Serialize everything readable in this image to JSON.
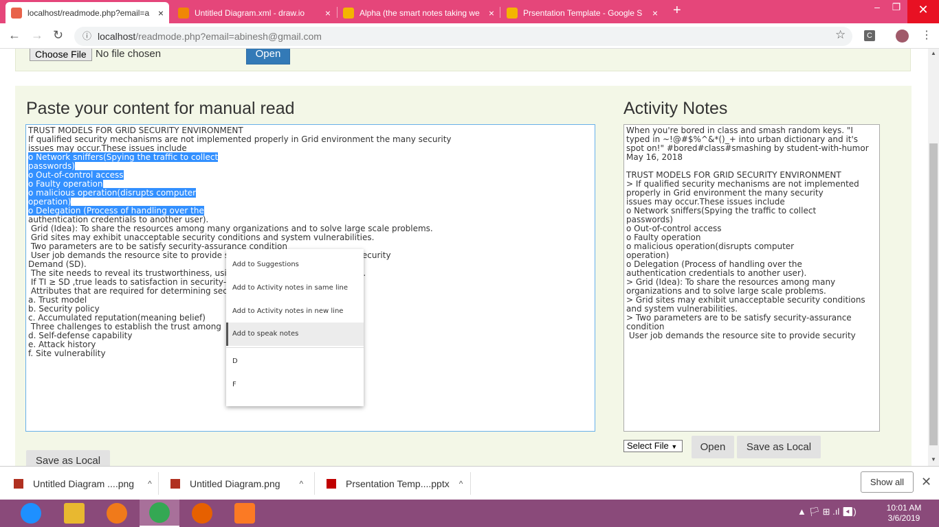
{
  "browser": {
    "tabs": [
      {
        "title": "localhost/readmode.php?email=a",
        "favicon_color": "#e8624a",
        "close": "×"
      },
      {
        "title": "Untitled Diagram.xml - draw.io",
        "favicon_color": "#f08705",
        "close": "×"
      },
      {
        "title": "Alpha (the smart notes taking we",
        "favicon_color": "#f4b400",
        "close": "×"
      },
      {
        "title": "Prsentation Template - Google S",
        "favicon_color": "#f4b400",
        "close": "×"
      }
    ],
    "new_tab": "+",
    "window_controls": [
      "–",
      "❐",
      "✕"
    ],
    "url_host": "localhost",
    "url_path": "/readmode.php?email=abinesh@gmail.com",
    "extension_letter": "C"
  },
  "upper_panel": {
    "choose_file": "Choose File",
    "no_file": "No file chosen",
    "open": "Open"
  },
  "manual": {
    "heading": "Paste your content for manual read",
    "lines": [
      {
        "text": "TRUST MODELS FOR GRID SECURITY ENVIRONMENT",
        "sel": false
      },
      {
        "text": "If qualified security mechanisms are not implemented properly in Grid environment the many security",
        "sel": false
      },
      {
        "text": "issues may occur.These issues include",
        "sel": false
      },
      {
        "text": "o Network sniffers(Spying the traffic to collect",
        "sel": true
      },
      {
        "text": "passwords)",
        "sel": true
      },
      {
        "text": "o Out-of-control access",
        "sel": true
      },
      {
        "text": "o Faulty operation",
        "sel": true
      },
      {
        "text": "o malicious operation(disrupts computer",
        "sel": true
      },
      {
        "text": "operation)",
        "sel": true
      },
      {
        "text": "o Delegation (Process of handling over the",
        "sel": true
      },
      {
        "text": "authentication credentials to another user).",
        "sel": false
      },
      {
        "text": " Grid (Idea): To share the resources among many organizations and to solve large scale problems.",
        "sel": false
      },
      {
        "text": " Grid sites may exhibit unacceptable security conditions and system vulnerabilities.",
        "sel": false
      },
      {
        "text": " Two parameters are to be satisfy security-assurance condition",
        "sel": false
      },
      {
        "text": " User job demands the resource site to provide security assurance by issuing a Security",
        "sel": false
      },
      {
        "text": "Demand (SD).",
        "sel": false
      },
      {
        "text": " The site needs to reveal its trustworthiness, using the parameter trust index (TI).",
        "sel": false
      },
      {
        "text": " If TI ≥ SD ,true leads to satisfaction in security-assurance",
        "sel": false
      },
      {
        "text": " Attributes that are required for determining security demand.",
        "sel": false
      },
      {
        "text": "a. Trust model",
        "sel": false
      },
      {
        "text": "b. Security policy",
        "sel": false
      },
      {
        "text": "c. Accumulated reputation(meaning belief)",
        "sel": false
      },
      {
        "text": " Three challenges to establish the trust among",
        "sel": false
      },
      {
        "text": "d. Self-defense capability",
        "sel": false
      },
      {
        "text": "e. Attack history",
        "sel": false
      },
      {
        "text": "f. Site vulnerability",
        "sel": false
      }
    ],
    "save_local": "Save as Local"
  },
  "context_menu": {
    "items": [
      "Add to Suggestions",
      "Add to Activity notes in same line",
      "Add to Activity notes in new line",
      "Add to speak notes",
      "D",
      "F"
    ]
  },
  "notes": {
    "heading": "Activity Notes",
    "lines": [
      "When you're bored in class and smash random keys. \"I",
      "typed in ~!@#$%^&*()_+ into urban dictionary and it's",
      "spot on!\" #bored#class#smashing by student-with-humor",
      "May 16, 2018",
      "",
      "TRUST MODELS FOR GRID SECURITY ENVIRONMENT",
      "> If qualified security mechanisms are not implemented",
      "properly in Grid environment the many security",
      "issues may occur.These issues include",
      "o Network sniffers(Spying the traffic to collect",
      "passwords)",
      "o Out-of-control access",
      "o Faulty operation",
      "o malicious operation(disrupts computer",
      "operation)",
      "o Delegation (Process of handling over the",
      "authentication credentials to another user).",
      "> Grid (Idea): To share the resources among many",
      "organizations and to solve large scale problems.",
      "> Grid sites may exhibit unacceptable security conditions",
      "and system vulnerabilities.",
      "> Two parameters are to be satisfy security-assurance",
      "condition",
      " User job demands the resource site to provide security"
    ],
    "select_file": "Select File",
    "select_arrow": "▼",
    "open": "Open",
    "save_local": "Save as Local"
  },
  "downloads": {
    "items": [
      {
        "name": "Untitled Diagram ....png",
        "caret": "^",
        "icon_color": "#b03020"
      },
      {
        "name": "Untitled Diagram.png",
        "caret": "^",
        "icon_color": "#b03020"
      },
      {
        "name": "Prsentation Temp....pptx",
        "caret": "^",
        "icon_color": "#c00000"
      }
    ],
    "show_all": "Show all",
    "close": "✕"
  },
  "taskbar": {
    "apps": [
      {
        "name": "ie",
        "color": "#1e90ff"
      },
      {
        "name": "explorer",
        "color": "#e8b830"
      },
      {
        "name": "uc-browser",
        "color": "#f07a1a"
      },
      {
        "name": "chrome",
        "color": "#34a853"
      },
      {
        "name": "firefox",
        "color": "#e66000"
      },
      {
        "name": "xampp",
        "color": "#fb7a24"
      }
    ],
    "tray": "▲ 🏳 ⊞ .ıl ◀)",
    "time": "10:01 AM",
    "date": "3/6/2019"
  }
}
